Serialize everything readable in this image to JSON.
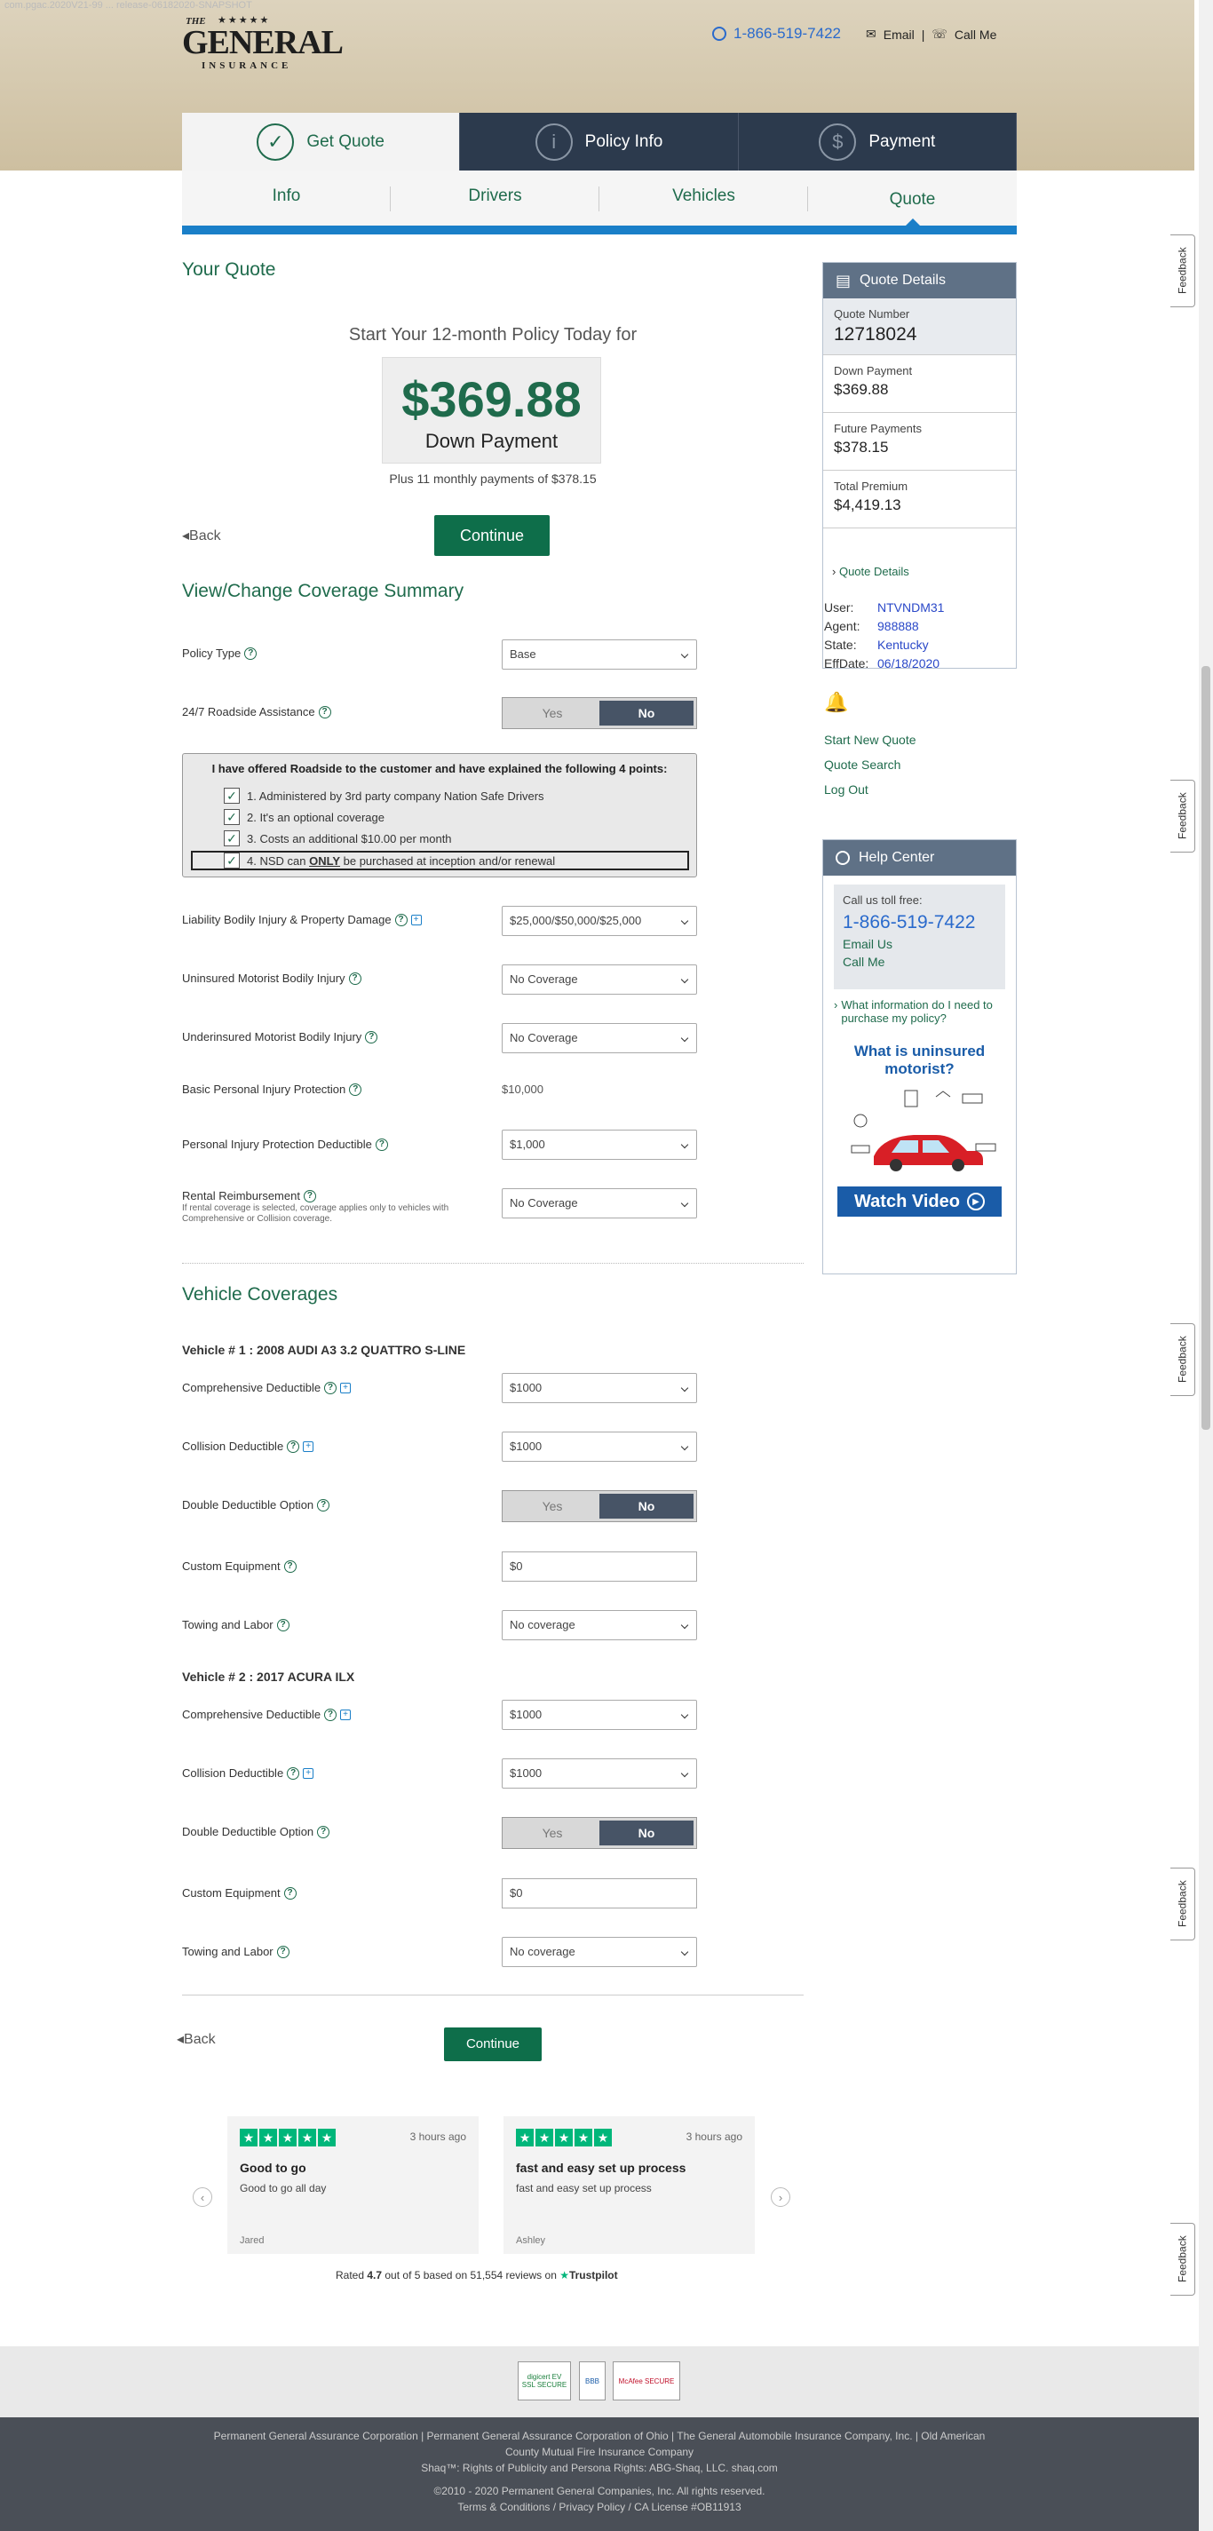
{
  "url_overlay": "com.pgac.2020V21-99 ... release-06182020-SNAPSHOT",
  "header": {
    "logo_the": "THE",
    "logo_name": "GENERAL",
    "logo_sub": "INSURANCE",
    "phone": "1-866-519-7422",
    "email_label": "Email",
    "call_label": "Call Me",
    "separator": "|"
  },
  "steps": [
    {
      "label": "Get Quote",
      "icon": "check-icon"
    },
    {
      "label": "Policy Info",
      "icon": "info-icon"
    },
    {
      "label": "Payment",
      "icon": "dollar-icon"
    }
  ],
  "subtabs": [
    "Info",
    "Drivers",
    "Vehicles",
    "Quote"
  ],
  "quote": {
    "heading": "Your Quote",
    "start_line": "Start Your 12-month Policy Today for",
    "amount": "$369.88",
    "down_payment_label": "Down Payment",
    "plus_line": "Plus 11 monthly payments of $378.15",
    "back_label": "Back",
    "continue_label": "Continue"
  },
  "coverage": {
    "heading": "View/Change Coverage Summary",
    "policy_type_label": "Policy Type",
    "policy_type_value": "Base",
    "roadside_label": "24/7 Roadside Assistance",
    "yes": "Yes",
    "no": "No",
    "roadside_box_title": "I have offered Roadside to the customer and have explained the following 4 points:",
    "roadside_points": [
      "1. Administered by 3rd party company Nation Safe Drivers",
      "2. It's an optional coverage",
      "3. Costs an additional $10.00 per month"
    ],
    "roadside_point4_a": "4. NSD can ",
    "roadside_point4_b": "ONLY",
    "roadside_point4_c": " be purchased at inception and/or renewal",
    "liability_label": "Liability Bodily Injury & Property Damage",
    "liability_value": "$25,000/$50,000/$25,000",
    "um_label": "Uninsured Motorist Bodily Injury",
    "um_value": "No Coverage",
    "uim_label": "Underinsured Motorist Bodily Injury",
    "uim_value": "No Coverage",
    "pip_label": "Basic Personal Injury Protection",
    "pip_value": "$10,000",
    "pipd_label": "Personal Injury Protection Deductible",
    "pipd_value": "$1,000",
    "rental_label": "Rental Reimbursement",
    "rental_value": "No Coverage",
    "rental_note": "If rental coverage is selected, coverage applies only to vehicles with Comprehensive or Collision coverage."
  },
  "vehicles": {
    "heading": "Vehicle Coverages",
    "comp_label": "Comprehensive Deductible",
    "coll_label": "Collision Deductible",
    "dd_label": "Double Deductible Option",
    "ce_label": "Custom Equipment",
    "tl_label": "Towing and Labor",
    "list": [
      {
        "title": "Vehicle # 1 : 2008 AUDI A3 3.2 QUATTRO S-LINE",
        "comp": "$1000",
        "coll": "$1000",
        "custom": "$0",
        "towing": "No coverage"
      },
      {
        "title": "Vehicle # 2 : 2017 ACURA ILX",
        "comp": "$1000",
        "coll": "$1000",
        "custom": "$0",
        "towing": "No coverage"
      }
    ]
  },
  "sidebar": {
    "qd_title": "Quote Details",
    "quote_number_label": "Quote Number",
    "quote_number": "12718024",
    "down_label": "Down Payment",
    "down_value": "$369.88",
    "future_label": "Future Payments",
    "future_value": "$378.15",
    "total_label": "Total Premium",
    "total_value": "$4,419.13",
    "quote_details_link": "Quote Details",
    "user_label": "User:",
    "user": "NTVNDM31",
    "agent_label": "Agent:",
    "agent": "988888",
    "state_label": "State:",
    "state": "Kentucky",
    "eff_label": "EffDate:",
    "eff": "06/18/2020",
    "start_new": "Start New Quote",
    "quote_search": "Quote Search",
    "log_out": "Log Out",
    "hc_title": "Help Center",
    "hc_call_label": "Call us toll free:",
    "hc_phone": "1-866-519-7422",
    "hc_email": "Email Us",
    "hc_call": "Call Me",
    "hc_info_link": "What information do I need to purchase my policy?",
    "promo_title": "What is uninsured motorist?",
    "watch_video": "Watch Video"
  },
  "bottom": {
    "back_label": "Back",
    "continue_label": "Continue"
  },
  "reviews": [
    {
      "title": "Good to go",
      "body": "Good to go all day",
      "ago": "3 hours ago",
      "name": "Jared"
    },
    {
      "title": "fast and easy set up process",
      "body": "fast and easy set up process",
      "ago": "3 hours ago",
      "name": "Ashley"
    }
  ],
  "trustpilot": {
    "a": "Rated ",
    "score": "4.7",
    "b": " out of 5 based on ",
    "reviews": "51,554 reviews",
    "c": " on ",
    "brand": "Trustpilot"
  },
  "feedback_label": "Feedback",
  "badges": [
    "digicert EV SSL SECURE",
    "BBB",
    "McAfee SECURE"
  ],
  "footer": {
    "line1": "Permanent General Assurance Corporation | Permanent General Assurance Corporation of Ohio | The General Automobile Insurance Company, Inc. | Old American",
    "line2": "County Mutual Fire Insurance Company",
    "line3": "Shaq™: Rights of Publicity and Persona Rights: ABG-Shaq, LLC. shaq.com",
    "line4": "©2010 - 2020 Permanent General Companies, Inc. All rights reserved.",
    "terms": "Terms & Conditions",
    "privacy": "Privacy Policy",
    "license": " / CA License #OB11913"
  }
}
